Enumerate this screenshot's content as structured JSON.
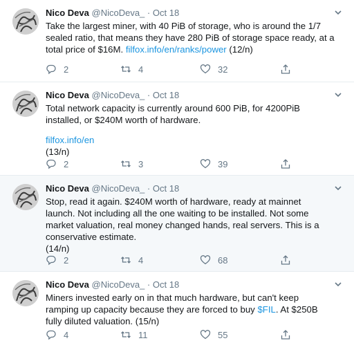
{
  "tweets": [
    {
      "name": "Nico Deva",
      "handle": "@NicoDeva_",
      "separator": "·",
      "date": "Oct 18",
      "lines": [
        [
          "Take the largest miner, with 40 PiB of storage, who is around the 1/7"
        ],
        [
          "sealed ratio, that means they have 280 PiB of storage space ready, at a"
        ],
        [
          "total price of $16M. ",
          "filfox.info/en/ranks/power",
          " (12/n)"
        ]
      ],
      "reply_count": "2",
      "retweet_count": "4",
      "like_count": "32"
    },
    {
      "name": "Nico Deva",
      "handle": "@NicoDeva_",
      "separator": "·",
      "date": "Oct 18",
      "lines": [
        [
          "Total network capacity is currently around 600 PiB, for 4200PiB"
        ],
        [
          "installed, or $240M worth of hardware."
        ],
        [
          ""
        ],
        [
          "filfox.info/en"
        ],
        [
          "(13/n)"
        ]
      ],
      "reply_count": "2",
      "retweet_count": "3",
      "like_count": "39"
    },
    {
      "name": "Nico Deva",
      "handle": "@NicoDeva_",
      "separator": "·",
      "date": "Oct 18",
      "lines": [
        [
          "Stop, read it again. $240M worth of hardware, ready at mainnet"
        ],
        [
          "launch. Not including all the one waiting to be installed. Not some"
        ],
        [
          "market valuation, real money changed hands, real servers. This is a"
        ],
        [
          "conservative estimate."
        ],
        [
          "(14/n)"
        ]
      ],
      "reply_count": "2",
      "retweet_count": "4",
      "like_count": "68"
    },
    {
      "name": "Nico Deva",
      "handle": "@NicoDeva_",
      "separator": "·",
      "date": "Oct 18",
      "lines": [
        [
          "Miners invested early on in that much hardware, but can't keep"
        ],
        [
          "ramping up capacity because they are forced to buy ",
          "$FIL",
          ". At $250B"
        ],
        [
          "fully diluted valuation. (15/n)"
        ]
      ],
      "reply_count": "4",
      "retweet_count": "11",
      "like_count": "55"
    }
  ],
  "icons": {
    "reply": "reply-icon",
    "retweet": "retweet-icon",
    "like": "like-icon",
    "share": "share-icon",
    "more": "chevron-down-icon"
  },
  "colors": {
    "link": "#1b95e0",
    "muted": "#657786",
    "text": "#14171a",
    "highlight_bg": "#f5f8fa",
    "divider": "#e6ecf0"
  }
}
